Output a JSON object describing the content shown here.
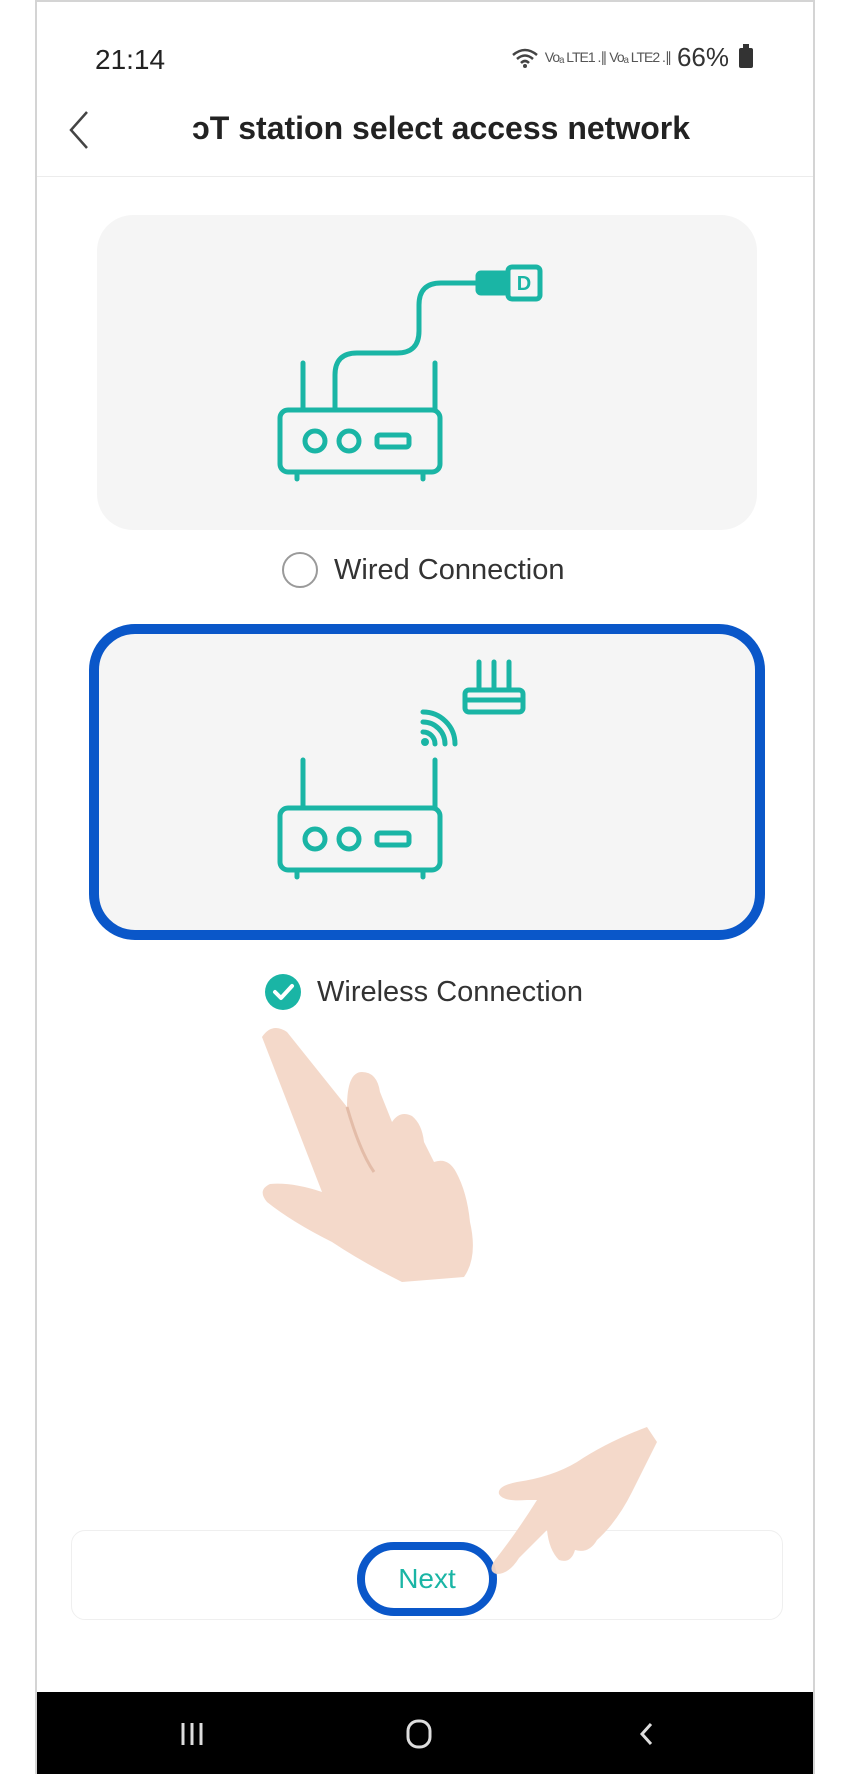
{
  "status_bar": {
    "time": "21:14",
    "signal_text": "Voₐ LTE1 .∥ Voₐ LTE2 .∥",
    "battery": "66%"
  },
  "header": {
    "title": "ɔT station select access network"
  },
  "options": [
    {
      "label": "Wired Connection",
      "selected": false
    },
    {
      "label": "Wireless Connection",
      "selected": true
    }
  ],
  "footer": {
    "next_label": "Next"
  },
  "colors": {
    "accent": "#1ab5a5",
    "highlight": "#0a57c9",
    "card_bg": "#f5f5f5"
  },
  "icons": {
    "back": "chevron-left-icon",
    "wired": "router-cable-icon",
    "wireless": "router-wifi-icon",
    "nav_recent": "recent-apps-icon",
    "nav_home": "home-icon",
    "nav_back": "back-arrow-icon"
  }
}
